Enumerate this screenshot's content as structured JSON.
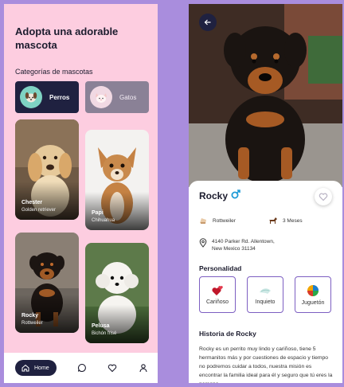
{
  "home": {
    "title": "Adopta una adorable mascota",
    "categories_title": "Categorías de mascotas",
    "categories": [
      {
        "label": "Perros",
        "icon": "dog-icon",
        "selected": true
      },
      {
        "label": "Gatos",
        "icon": "cat-icon",
        "selected": false
      }
    ],
    "pets": [
      {
        "name": "Chester",
        "breed": "Golden retriever"
      },
      {
        "name": "Papi",
        "breed": "Chihuahua"
      },
      {
        "name": "Rocky",
        "breed": "Rottweiler"
      },
      {
        "name": "Pelusa",
        "breed": "Bichón frisé"
      }
    ],
    "nav": {
      "home_label": "Home"
    }
  },
  "detail": {
    "name": "Rocky",
    "breed": "Rottweiler",
    "age": "3 Meses",
    "address_line1": "4140 Parker Rd. Allentown,",
    "address_line2": "New Mexico 31134",
    "personality_title": "Personalidad",
    "traits": [
      "Cariñoso",
      "Inquieto",
      "Juguetón"
    ],
    "story_title": "Historia de Rocky",
    "story": "Rocky es un perrito muy lindo y cariñoso, tiene 5 hermanitos más y por cuestiones de espacio y tiempo no podremos cuidar a todos, nuestra misión es encontrar la familia ideal para él y seguro que tú eres la persona"
  },
  "colors": {
    "background": "#a98ddd",
    "home_bg": "#fdcde0",
    "navy": "#1f2140",
    "accent_purple": "#7d5fc2",
    "male_blue": "#1e9bd7"
  }
}
